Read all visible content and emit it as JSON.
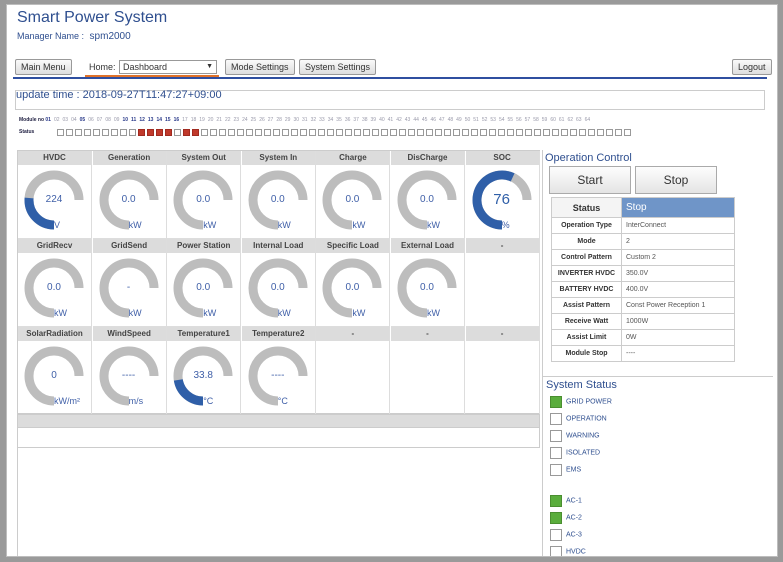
{
  "app": {
    "title": "Smart Power System",
    "manager_label": "Manager Name :",
    "manager_value": "spm2000"
  },
  "nav": {
    "main_menu": "Main Menu",
    "home_label": "Home:",
    "home_selected": "Dashboard",
    "mode_settings": "Mode Settings",
    "system_settings": "System Settings",
    "logout": "Logout"
  },
  "update": {
    "text": "update time : 2018-09-27T11:47:27+09:00"
  },
  "modules": {
    "label": "Module no",
    "status_label": "Status",
    "numbers": [
      "01",
      "02",
      "03",
      "04",
      "05",
      "06",
      "07",
      "08",
      "09",
      "10",
      "11",
      "12",
      "13",
      "14",
      "15",
      "16",
      "17",
      "18",
      "19",
      "20",
      "21",
      "22",
      "23",
      "24",
      "25",
      "26",
      "27",
      "28",
      "29",
      "30",
      "31",
      "32",
      "33",
      "34",
      "35",
      "36",
      "37",
      "38",
      "39",
      "40",
      "41",
      "42",
      "43",
      "44",
      "45",
      "46",
      "47",
      "48",
      "49",
      "50",
      "51",
      "52",
      "53",
      "54",
      "55",
      "56",
      "57",
      "58",
      "59",
      "60",
      "61",
      "62",
      "63",
      "64"
    ],
    "active_numbers": [
      "01",
      "05",
      "10",
      "11",
      "12",
      "13",
      "14",
      "15",
      "16"
    ],
    "red_status": [
      10,
      11,
      12,
      13,
      15,
      16
    ]
  },
  "gauges": [
    {
      "label": "HVDC",
      "value": "224",
      "unit": "V",
      "level": 0.35,
      "big": false
    },
    {
      "label": "Generation",
      "value": "0.0",
      "unit": "kW",
      "level": 0,
      "big": false
    },
    {
      "label": "System Out",
      "value": "0.0",
      "unit": "kW",
      "level": 0,
      "big": false
    },
    {
      "label": "System In",
      "value": "0.0",
      "unit": "kW",
      "level": 0,
      "big": false
    },
    {
      "label": "Charge",
      "value": "0.0",
      "unit": "kW",
      "level": 0,
      "big": false
    },
    {
      "label": "DisCharge",
      "value": "0.0",
      "unit": "kW",
      "level": 0,
      "big": false
    },
    {
      "label": "SOC",
      "value": "76",
      "unit": "%",
      "level": 0.76,
      "big": true
    },
    {
      "label": "GridRecv",
      "value": "0.0",
      "unit": "kW",
      "level": 0,
      "big": false
    },
    {
      "label": "GridSend",
      "value": "-",
      "unit": "kW",
      "level": 0,
      "big": false
    },
    {
      "label": "Power Station",
      "value": "0.0",
      "unit": "kW",
      "level": 0,
      "big": false
    },
    {
      "label": "Internal Load",
      "value": "0.0",
      "unit": "kW",
      "level": 0,
      "big": false
    },
    {
      "label": "Specific Load",
      "value": "0.0",
      "unit": "kW",
      "level": 0,
      "big": false
    },
    {
      "label": "External Load",
      "value": "0.0",
      "unit": "kW",
      "level": 0,
      "big": false
    },
    {
      "label": "-",
      "value": null,
      "unit": null,
      "level": 0,
      "big": false
    },
    {
      "label": "SolarRadiation",
      "value": "0",
      "unit": "kW/m²",
      "level": 0,
      "big": false
    },
    {
      "label": "WindSpeed",
      "value": "----",
      "unit": "m/s",
      "level": 0,
      "big": false
    },
    {
      "label": "Temperature1",
      "value": "33.8",
      "unit": "°C",
      "level": 0.3,
      "big": false
    },
    {
      "label": "Temperature2",
      "value": "----",
      "unit": "°C",
      "level": 0,
      "big": false
    },
    {
      "label": "-",
      "value": null,
      "unit": null,
      "level": 0,
      "big": false
    },
    {
      "label": "-",
      "value": null,
      "unit": null,
      "level": 0,
      "big": false
    },
    {
      "label": "-",
      "value": null,
      "unit": null,
      "level": 0,
      "big": false
    }
  ],
  "operation": {
    "title": "Operation Control",
    "start": "Start",
    "stop": "Stop",
    "status_key": "Status",
    "status_value": "Stop",
    "rows": [
      {
        "k": "Operation Type",
        "v": "InterConnect"
      },
      {
        "k": "Mode",
        "v": "2"
      },
      {
        "k": "Control Pattern",
        "v": "Custom 2"
      },
      {
        "k": "INVERTER HVDC",
        "v": "350.0V"
      },
      {
        "k": "BATTERY HVDC",
        "v": "400.0V"
      },
      {
        "k": "Assist Pattern",
        "v": "Const Power Reception 1"
      },
      {
        "k": "Receive Watt",
        "v": "1000W"
      },
      {
        "k": "Assist Limit",
        "v": "0W"
      },
      {
        "k": "Module Stop",
        "v": "----"
      }
    ]
  },
  "system_status": {
    "title": "System Status",
    "items": [
      {
        "label": "GRID POWER",
        "on": true
      },
      {
        "label": "OPERATION",
        "on": false
      },
      {
        "label": "WARNING",
        "on": false
      },
      {
        "label": "ISOLATED",
        "on": false
      },
      {
        "label": "EMS",
        "on": false
      },
      {
        "label": "AC-1",
        "on": true
      },
      {
        "label": "AC-2",
        "on": true
      },
      {
        "label": "AC-3",
        "on": false
      },
      {
        "label": "HVDC",
        "on": false
      }
    ],
    "colors": {
      "on": "#5aad3c",
      "accent": "#2f5fa8"
    }
  }
}
